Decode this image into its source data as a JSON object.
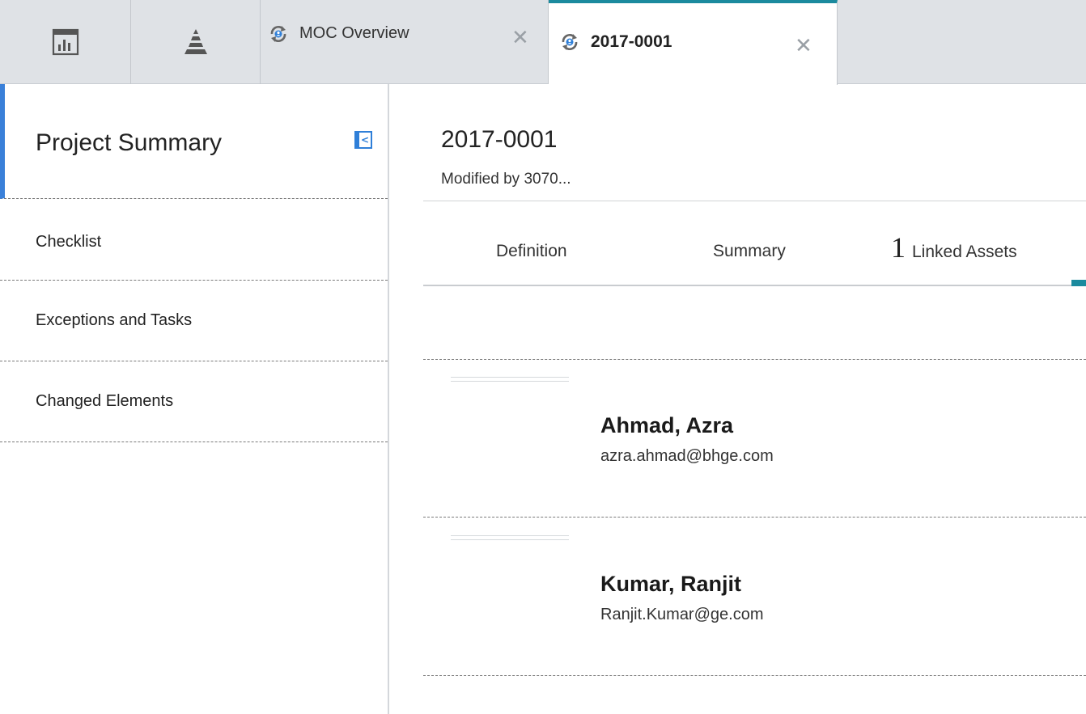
{
  "tabs": {
    "tab1_icon": "report-grid-icon",
    "tab2_icon": "pyramid-icon",
    "moc_overview_label": "MOC Overview",
    "record_tab_label": "2017-0001",
    "close_glyph": "✕",
    "active_color": "#1b8a9e"
  },
  "sidebar": {
    "title": "Project Summary",
    "collapse_glyph": "<",
    "items": [
      {
        "label": "Checklist"
      },
      {
        "label": "Exceptions and Tasks"
      },
      {
        "label": "Changed Elements"
      }
    ],
    "accent_color": "#3a80d9"
  },
  "record": {
    "title": "2017-0001",
    "modified": "Modified by 3070..."
  },
  "subtabs": {
    "definition": "Definition",
    "summary": "Summary",
    "linked_count": "1",
    "linked_label": "Linked Assets"
  },
  "people": [
    {
      "name": "Ahmad, Azra",
      "email": "azra.ahmad@bhge.com"
    },
    {
      "name": "Kumar, Ranjit",
      "email": "Ranjit.Kumar@ge.com"
    }
  ]
}
